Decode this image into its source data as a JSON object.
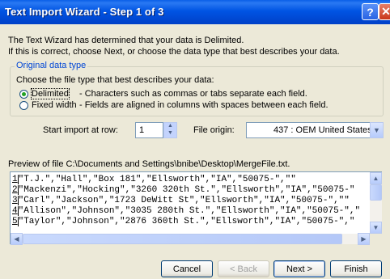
{
  "window": {
    "title": "Text Import Wizard - Step 1 of 3"
  },
  "intro": [
    "The Text Wizard has determined that your data is Delimited.",
    "If this is correct, choose Next, or choose the data type that best describes your data."
  ],
  "data_type": {
    "legend": "Original data type",
    "instruction": "Choose the file type that best describes your data:",
    "options": [
      {
        "label": "Delimited",
        "description": "- Characters such as commas or tabs separate each field.",
        "selected": true
      },
      {
        "label": "Fixed width",
        "description": "- Fields are aligned in columns with spaces between each field.",
        "selected": false
      }
    ]
  },
  "start_row": {
    "label": "Start import at row:",
    "value": "1"
  },
  "file_origin": {
    "label": "File origin:",
    "value": "437 : OEM United States"
  },
  "preview": {
    "label": "Preview of file C:\\Documents and Settings\\bnibe\\Desktop\\MergeFile.txt.",
    "lines": [
      {
        "num": "1",
        "text": "\"T.J.\",\"Hall\",\"Box 181\",\"Ellsworth\",\"IA\",\"50075-\",\"\""
      },
      {
        "num": "2",
        "text": "\"Mackenzi\",\"Hocking\",\"3260 320th St.\",\"Ellsworth\",\"IA\",\"50075-\""
      },
      {
        "num": "3",
        "text": "\"Carl\",\"Jackson\",\"1723 DeWitt St\",\"Ellsworth\",\"IA\",\"50075-\",\"\""
      },
      {
        "num": "4",
        "text": "\"Allison\",\"Johnson\",\"3035 280th St.\",\"Ellsworth\",\"IA\",\"50075-\",\""
      },
      {
        "num": "5",
        "text": "\"Taylor\",\"Johnson\",\"2876 360th St.\",\"Ellsworth\",\"IA\",\"50075-\",\""
      }
    ]
  },
  "buttons": {
    "cancel": "Cancel",
    "back": "< Back",
    "next": "Next >",
    "finish": "Finish"
  },
  "icons": {
    "help": "help-icon",
    "close": "close-icon"
  }
}
